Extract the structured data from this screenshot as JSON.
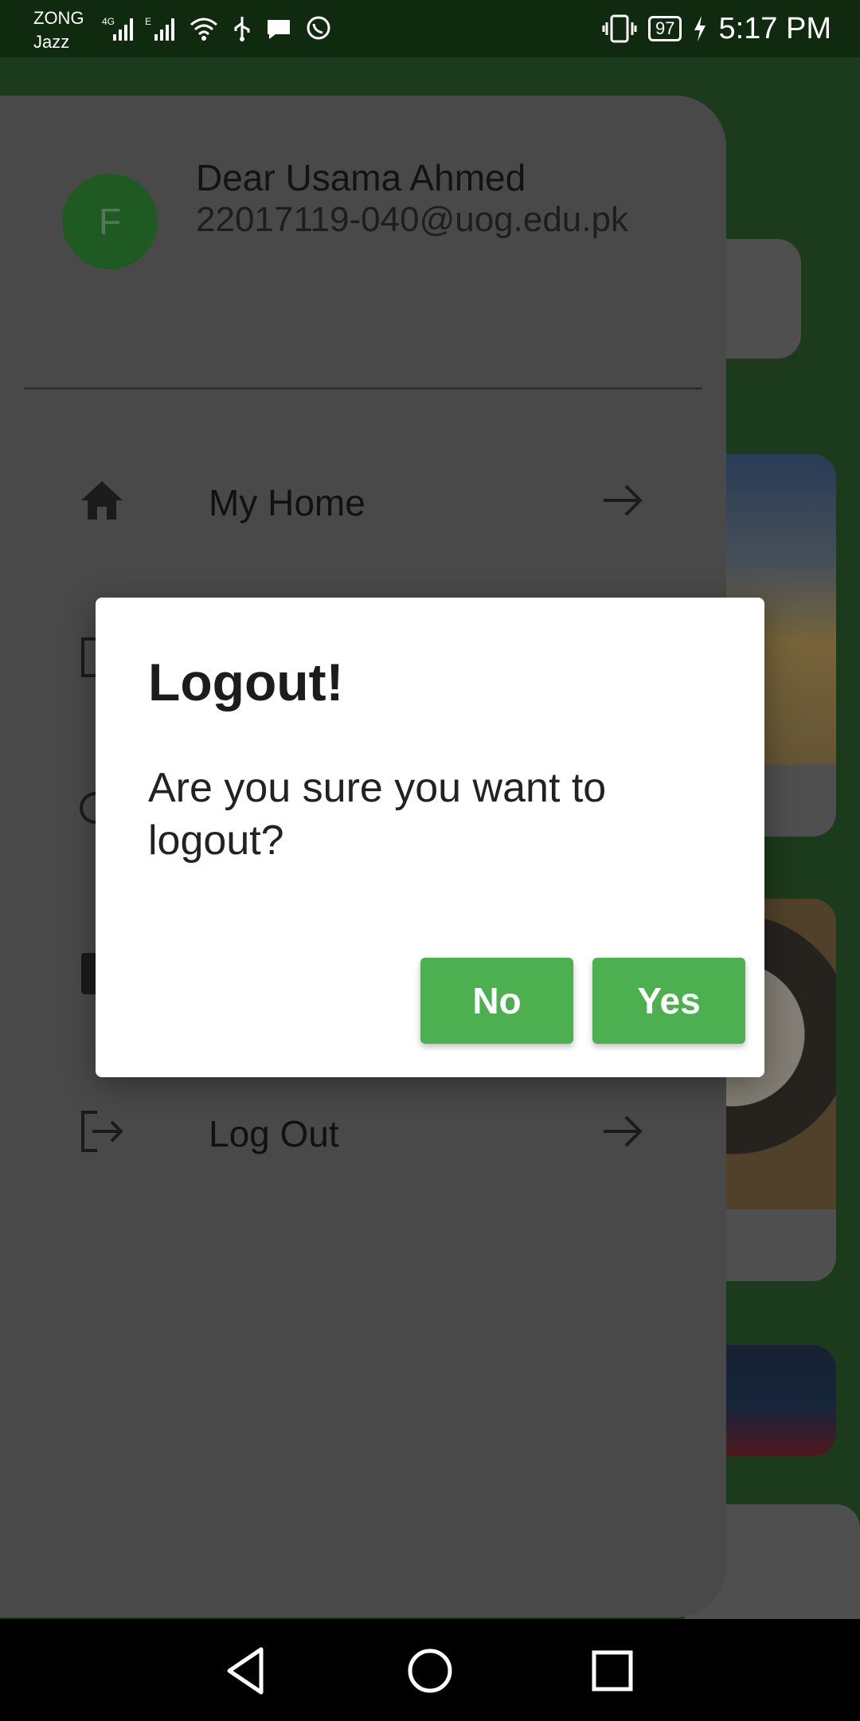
{
  "status_bar": {
    "carrier_line1": "ZONG",
    "carrier_line2": "Jazz",
    "battery_level": "97",
    "time": "5:17 PM",
    "icons": [
      "signal-4g-icon",
      "signal-e-icon",
      "wifi-icon",
      "usb-icon",
      "message-icon",
      "whatsapp-icon",
      "vibrate-icon",
      "battery-icon",
      "charging-icon"
    ]
  },
  "drawer": {
    "avatar_initial": "F",
    "user_name": "Dear Usama Ahmed",
    "user_email": "22017119-040@uog.edu.pk",
    "menu": [
      {
        "label": "My Home",
        "icon": "home-icon"
      },
      {
        "label": "Log Out",
        "icon": "logout-icon"
      }
    ]
  },
  "dialog": {
    "title": "Logout!",
    "message": "Are you sure you want to logout?",
    "no_label": "No",
    "yes_label": "Yes",
    "button_color": "#4caf50"
  },
  "nav_bar": {
    "buttons": [
      "back-icon",
      "home-circle-icon",
      "recents-icon"
    ]
  }
}
